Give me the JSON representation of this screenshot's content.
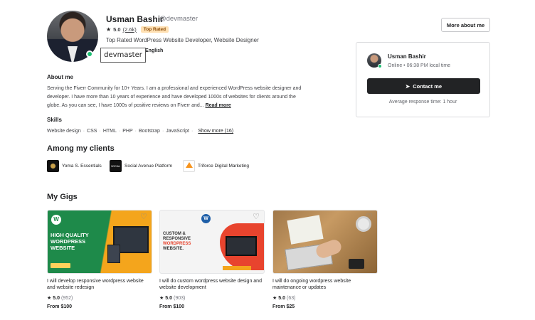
{
  "profile": {
    "name": "Usman Bashir",
    "handle": "@devmaster",
    "rating": "5.0",
    "review_count": "(2.6k)",
    "level_badge": "Top Rated",
    "tagline": "Top Rated WordPress Website Developer, Website Designer",
    "language": "English",
    "tooltip": "devmaster"
  },
  "about": {
    "heading": "About me",
    "text": "Serving the Fiverr Community for 10+ Years. I am a professional and experienced WordPress website designer and developer. I have more than 10 years of experience and have developed 1000s of websites for clients around the globe. As you can see, I have 1000s of positive reviews on Fiverr and...",
    "read_more": "Read more"
  },
  "skills": {
    "heading": "Skills",
    "items": [
      "Website design",
      "CSS",
      "HTML",
      "PHP",
      "Bootstrap",
      "JavaScript"
    ],
    "show_more": "Show more (16)"
  },
  "clients": {
    "heading": "Among my clients",
    "items": [
      {
        "name": "Yoma S. Essentials"
      },
      {
        "name": "Social Avenue Platform",
        "logo_text": "SOCIAL"
      },
      {
        "name": "Triforce Digital Marketing"
      }
    ]
  },
  "gigs": {
    "heading": "My Gigs",
    "items": [
      {
        "title": "I will develop responsive wordpress website and website redesign",
        "rating": "5.0",
        "count": "(952)",
        "price": "From $100",
        "thumb_text": [
          "HIGH QUALITY",
          "WORDPRESS",
          "WEBSITE"
        ]
      },
      {
        "title": "I will do custom wordpress website design and website development",
        "rating": "5.0",
        "count": "(903)",
        "price": "From $100",
        "thumb_text": [
          "CUSTOM &",
          "RESPONSIVE",
          "WORDPRESS",
          "WEBSITE."
        ]
      },
      {
        "title": "I will do ongoing wordpress website maintenance or updates",
        "rating": "5.0",
        "count": "(63)",
        "price": "From $25"
      }
    ]
  },
  "contact_card": {
    "name": "Usman Bashir",
    "status": "Online • 06:38 PM local time",
    "button_label": "Contact me",
    "response": "Average response time: 1 hour"
  },
  "header_actions": {
    "more_about_label": "More about me"
  },
  "colors": {
    "online": "#1dbf73",
    "badge_bg": "#ffe0b3",
    "button_dark": "#222325"
  }
}
